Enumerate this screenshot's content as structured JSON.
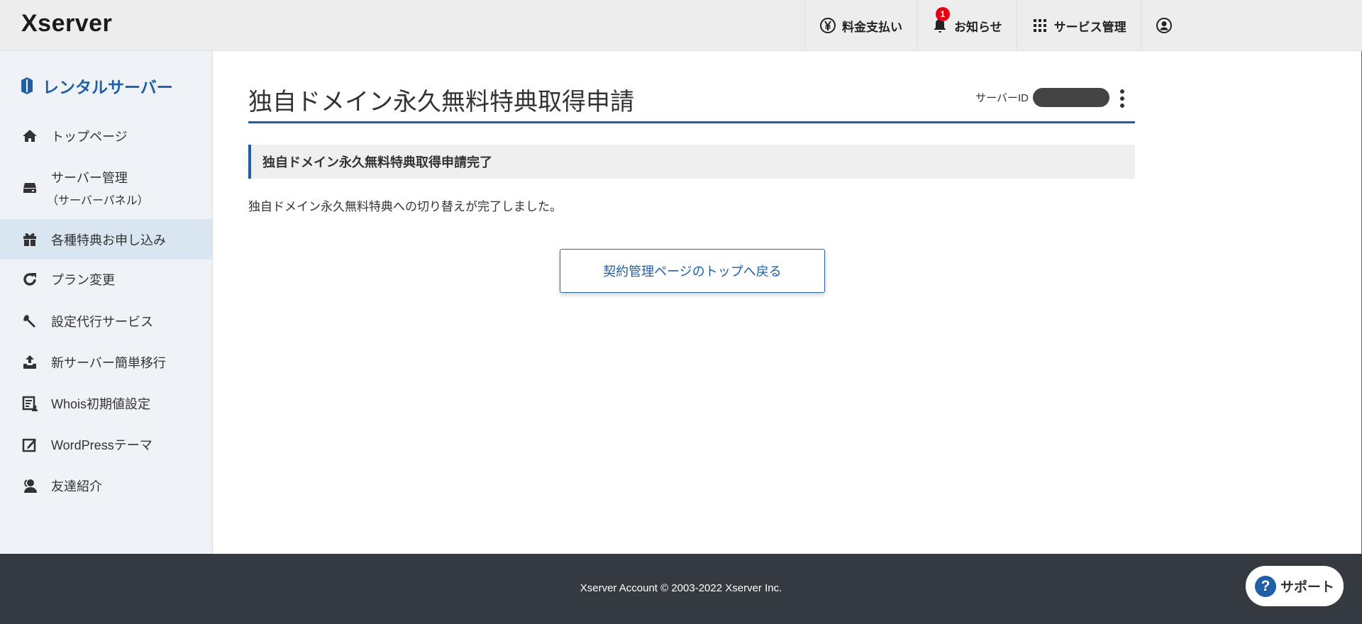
{
  "header": {
    "logo": "Xserver",
    "nav": [
      {
        "label": "料金支払い",
        "icon": "yen-icon"
      },
      {
        "label": "お知らせ",
        "icon": "bell-icon",
        "badge": "1"
      },
      {
        "label": "サービス管理",
        "icon": "grid-icon"
      },
      {
        "label": "",
        "icon": "user-icon"
      }
    ]
  },
  "sidebar": {
    "title": "レンタルサーバー",
    "items": [
      {
        "label": "トップページ"
      },
      {
        "label": "サーバー管理",
        "sub": "（サーバーパネル）"
      },
      {
        "label": "各種特典お申し込み",
        "active": true
      },
      {
        "label": "プラン変更"
      },
      {
        "label": "設定代行サービス"
      },
      {
        "label": "新サーバー簡単移行"
      },
      {
        "label": "Whois初期値設定"
      },
      {
        "label": "WordPressテーマ"
      },
      {
        "label": "友達紹介"
      }
    ]
  },
  "main": {
    "title": "独自ドメイン永久無料特典取得申請",
    "server_id_label": "サーバーID",
    "section_title": "独自ドメイン永久無料特典取得申請完了",
    "message": "独自ドメイン永久無料特典への切り替えが完了しました。",
    "back_button": "契約管理ページのトップへ戻る"
  },
  "footer": {
    "copyright": "Xserver Account © 2003-2022 Xserver Inc.",
    "support": "サポート",
    "support_icon": "?"
  },
  "colors": {
    "accent": "#1f5fa8",
    "footer": "#343a40",
    "sidebar": "#eff3f7",
    "badge": "#e60012"
  }
}
